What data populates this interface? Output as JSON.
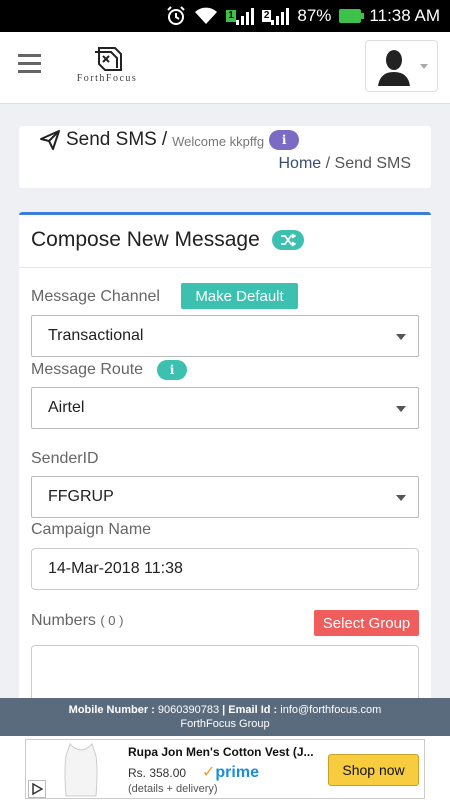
{
  "status_bar": {
    "battery": "87%",
    "time": "11:38 AM",
    "sim1": "1",
    "sim2": "2"
  },
  "header": {
    "logo_text": "ForthFocus"
  },
  "page": {
    "title": "Send SMS",
    "separator": "/",
    "welcome": "Welcome kkpffg",
    "info_icon": "i"
  },
  "breadcrumb": {
    "home": "Home",
    "separator": " / ",
    "current": "Send SMS"
  },
  "compose": {
    "title": "Compose New Message",
    "message_channel": {
      "label": "Message Channel",
      "value": "Transactional",
      "default_button": "Make Default"
    },
    "message_route": {
      "label": "Message Route",
      "value": "Airtel",
      "info_icon": "i"
    },
    "sender_id": {
      "label": "SenderID",
      "value": "FFGRUP"
    },
    "campaign_name": {
      "label": "Campaign Name",
      "value": "14-Mar-2018 11:38"
    },
    "numbers": {
      "label": "Numbers",
      "count": "( 0 )",
      "select_group_button": "Select Group"
    }
  },
  "footer": {
    "mobile_label": "Mobile Number :",
    "mobile_value": "9060390783",
    "separator": "|",
    "email_label": "Email Id :",
    "email_value": "info@forthfocus.com",
    "company": "ForthFocus Group"
  },
  "ad": {
    "title": "Rupa Jon Men's Cotton Vest (J...",
    "price": "Rs. 358.00",
    "prime": "prime",
    "subtext": "(details + delivery)",
    "button": "Shop now"
  },
  "colors": {
    "accent_blue": "#3c7dd9",
    "teal": "#3cc0b0",
    "red": "#ef5d5d",
    "purple": "#7b6bc4",
    "footer": "#5b6b7e",
    "ad_button": "#f7cc3e"
  },
  "icons": [
    "alarm-icon",
    "wifi-icon",
    "signal-icon",
    "battery-icon",
    "hamburger-icon",
    "logo-icon",
    "avatar-icon",
    "send-icon",
    "info-icon",
    "shuffle-icon",
    "ad-choices-icon"
  ]
}
